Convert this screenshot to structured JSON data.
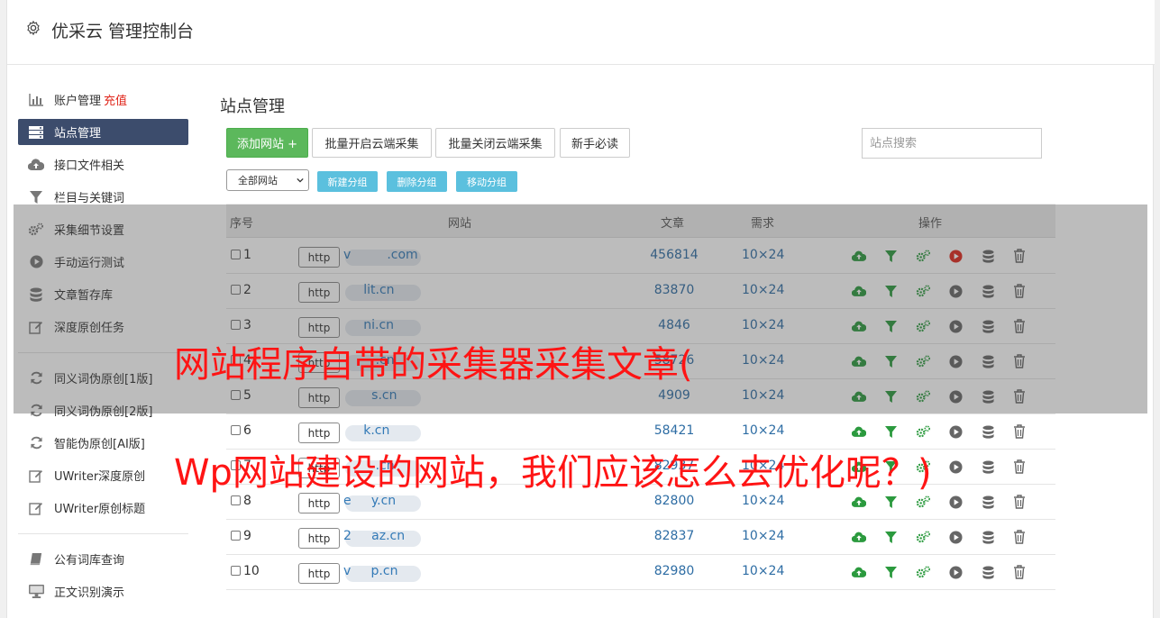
{
  "header": {
    "title": "优采云 管理控制台"
  },
  "sidebar": {
    "items": [
      {
        "label": "账户管理",
        "badge": "充值",
        "icon": "bar-chart-icon"
      },
      {
        "label": "站点管理",
        "icon": "server-icon",
        "active": true
      },
      {
        "label": "接口文件相关",
        "icon": "cloud-upload-icon"
      },
      {
        "label": "栏目与关键词",
        "icon": "filter-icon"
      },
      {
        "label": "采集细节设置",
        "icon": "cogs-icon"
      },
      {
        "label": "手动运行测试",
        "icon": "play-circle-icon"
      },
      {
        "label": "文章暂存库",
        "icon": "database-icon"
      },
      {
        "label": "深度原创任务",
        "icon": "edit-icon"
      },
      {
        "label": "同义词伪原创[1版]",
        "icon": "refresh-icon"
      },
      {
        "label": "同义词伪原创[2版]",
        "icon": "refresh-icon"
      },
      {
        "label": "智能伪原创[AI版]",
        "icon": "refresh-icon"
      },
      {
        "label": "UWriter深度原创",
        "icon": "edit-icon"
      },
      {
        "label": "UWriter原创标题",
        "icon": "edit-icon"
      },
      {
        "label": "公有词库查询",
        "icon": "book-icon"
      },
      {
        "label": "正文识别演示",
        "icon": "desktop-icon"
      }
    ]
  },
  "main": {
    "title": "站点管理",
    "toolbar": {
      "add_site": "添加网站 +",
      "batch_enable": "批量开启云端采集",
      "batch_disable": "批量关闭云端采集",
      "newbie": "新手必读",
      "search_placeholder": "站点搜索"
    },
    "group": {
      "select_value": "全部网站",
      "new_group": "新建分组",
      "delete_group": "删除分组",
      "move_group": "移动分组"
    },
    "table": {
      "headers": {
        "no": "序号",
        "site": "网站",
        "articles": "文章",
        "demand": "需求",
        "ops": "操作"
      },
      "http_label": "http",
      "rows": [
        {
          "no": "1",
          "site": "v         .com",
          "articles": "456814",
          "demand": "10×24",
          "play_red": true
        },
        {
          "no": "2",
          "site": "     lit.cn",
          "articles": "83870",
          "demand": "10×24"
        },
        {
          "no": "3",
          "site": "     ni.cn",
          "articles": "4846",
          "demand": "10×24"
        },
        {
          "no": "4",
          "site": "        .cn",
          "articles": "58726",
          "demand": "10×24"
        },
        {
          "no": "5",
          "site": "       s.cn",
          "articles": "4909",
          "demand": "10×24"
        },
        {
          "no": "6",
          "site": "     k.cn",
          "articles": "58421",
          "demand": "10×24"
        },
        {
          "no": "7",
          "site": "        .cn",
          "articles": "82937",
          "demand": "10×24"
        },
        {
          "no": "8",
          "site": "e     y.cn",
          "articles": "82800",
          "demand": "10×24"
        },
        {
          "no": "9",
          "site": "2     az.cn",
          "articles": "82837",
          "demand": "10×24"
        },
        {
          "no": "10",
          "site": "v     p.cn",
          "articles": "82980",
          "demand": "10×24"
        }
      ]
    }
  },
  "overlay": {
    "line1": "网站程序自带的采集器采集文章(",
    "line2": "Wp网站建设的网站，我们应该怎么去优化呢？)"
  },
  "colors": {
    "active_nav": "#3c4c6c",
    "add_button": "#5cb85c",
    "info_button": "#5bc0de",
    "link": "#2e6da4",
    "caption": "#ff1414",
    "upload_icon": "#2b9a3e",
    "play_active": "#e0261b"
  }
}
